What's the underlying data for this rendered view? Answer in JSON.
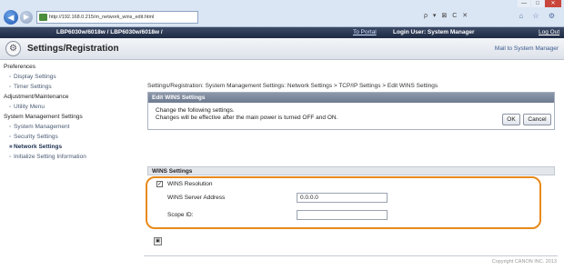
{
  "browser": {
    "url": "http://192.168.0.215/m_network_wins_edit.html",
    "url_actions": "ρ ▾ ⊠ C ✕",
    "window_buttons": [
      "—",
      "□",
      "✕"
    ],
    "tool_icons": "⌂ ☆ ⚙"
  },
  "header": {
    "model": "LBP6030w/6018w / LBP6030w/6018w /",
    "to_portal": "To Portal",
    "login_user": "Login User: System Manager",
    "logout": "Log Out"
  },
  "title": {
    "text": "Settings/Registration",
    "mail_link": "Mail to System Manager"
  },
  "sidebar": {
    "sections": [
      {
        "heading": "Preferences",
        "items": [
          "Display Settings",
          "Timer Settings"
        ]
      },
      {
        "heading": "Adjustment/Maintenance",
        "items": [
          "Utility Menu"
        ]
      },
      {
        "heading": "System Management Settings",
        "items": [
          "System Management",
          "Security Settings",
          "Network Settings",
          "Initialize Setting Information"
        ]
      }
    ],
    "active_item": "Network Settings"
  },
  "breadcrumb": "Settings/Registration: System Management Settings: Network Settings > TCP/IP Settings > Edit WINS Settings",
  "edit_panel": {
    "title": "Edit WINS Settings",
    "message_line1": "Change the following settings.",
    "message_line2": "Changes will be effective after the main power is turned OFF and ON.",
    "ok_label": "OK",
    "cancel_label": "Cancel"
  },
  "wins": {
    "section_title": "WINS Settings",
    "resolution_label": "WINS Resolution",
    "resolution_checked": true,
    "server_address_label": "WINS Server Address",
    "server_address_value": "0.0.0.0",
    "scope_id_label": "Scope ID:",
    "scope_id_value": ""
  },
  "footer": {
    "copyright": "Copyright CANON INC. 2013"
  },
  "colors": {
    "highlight": "#e88a1a",
    "header_bg": "#1e2a44"
  }
}
